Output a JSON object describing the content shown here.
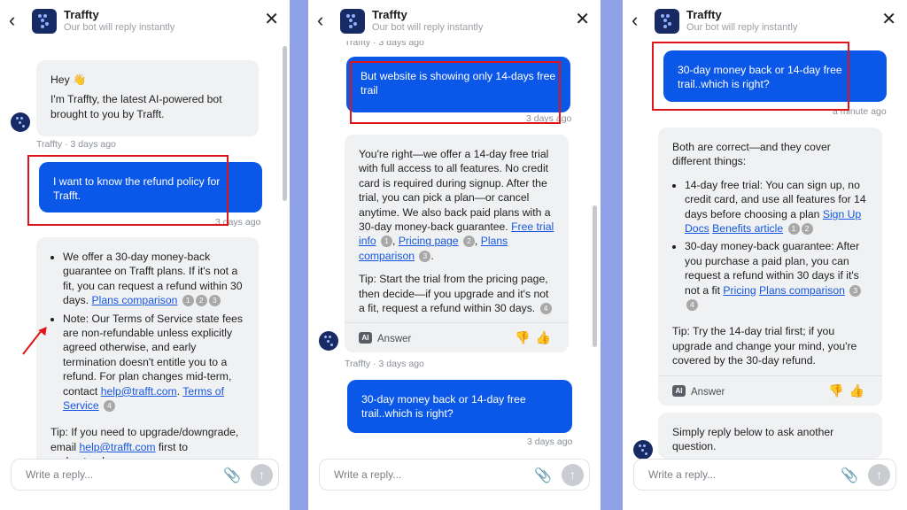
{
  "header": {
    "bot_name": "Traffty",
    "subtitle": "Our bot will reply instantly"
  },
  "input": {
    "placeholder": "Write a reply..."
  },
  "icons": {
    "back": "chevron-left-icon",
    "close": "close-icon",
    "attach": "paperclip-icon",
    "send": "arrow-up-icon",
    "thumbs_down": "thumbs-down-icon",
    "thumbs_up": "thumbs-up-icon"
  },
  "colors": {
    "user_bubble": "#0b57e8",
    "bot_bubble": "#f0f1f3",
    "annotation": "#e0141b",
    "link": "#1557e0",
    "background": "#8ea0e6"
  },
  "panel1": {
    "greeting_line1": "Hey 👋",
    "greeting_line2": "I'm Traffty, the latest AI-powered bot brought to you by Trafft.",
    "greeting_meta": "Traffty · 3 days ago",
    "user_msg": "I want to know the refund policy for Trafft.",
    "user_meta": "3 days ago",
    "b1_text": "We offer a 30-day money-back guarantee on Trafft plans. If it's not a fit, you can request a refund within 30 days.",
    "b1_link": "Plans comparison",
    "b1_cites": [
      "1",
      "2",
      "3"
    ],
    "b2_text": "Note: Our Terms of Service state fees are non-refundable unless explicitly agreed otherwise, and early termination doesn't entitle you to a refund. For plan changes mid-term, contact",
    "b2_email": "help@trafft.com",
    "b2_link": "Terms of Service",
    "b2_cite": "4",
    "tip_prefix": "Tip: If you need to upgrade/downgrade, email",
    "tip_email": "help@trafft.com",
    "tip_suffix": "first to understand"
  },
  "panel2": {
    "top_meta": "Traffty · 3 days ago",
    "user_msg1": "But website is showing only 14-days free trail",
    "user_meta1": "3 days ago",
    "bot_para": "You're right—we offer a 14-day free trial with full access to all features. No credit card is required during signup. After the trial, you can pick a plan—or cancel anytime. We also back paid plans with a 30-day money-back guarantee.",
    "link1": "Free trial info",
    "cite1": "1",
    "link2": "Pricing page",
    "cite2": "2",
    "link3": "Plans comparison",
    "cite3": "3",
    "tip": "Tip: Start the trial from the pricing page, then decide—if you upgrade and it's not a fit, request a refund within 30 days.",
    "tip_cite": "4",
    "answer_badge": "AI",
    "answer_label": "Answer",
    "bot_meta": "Traffty · 3 days ago",
    "user_msg2": "30-day money back or 14-day free trail..which is right?",
    "user_meta2": "3 days ago"
  },
  "panel3": {
    "user_msg": "30-day money back or 14-day free trail..which is right?",
    "user_meta": "a minute ago",
    "intro": "Both are correct—and they cover different things:",
    "li1_text": "14-day free trial: You can sign up, no credit card, and use all features for 14 days before choosing a plan",
    "li1_link1": "Sign Up Docs",
    "li1_link2": "Benefits article",
    "li1_cites": [
      "1",
      "2"
    ],
    "li2_text": "30-day money-back guarantee: After you purchase a paid plan, you can request a refund within 30 days if it's not a fit",
    "li2_link1": "Pricing",
    "li2_link2": "Plans comparison",
    "li2_cites": [
      "3",
      "4"
    ],
    "tip": "Tip: Try the 14-day trial first; if you upgrade and change your mind, you're covered by the 30-day refund.",
    "answer_badge": "AI",
    "answer_label": "Answer",
    "followup": "Simply reply below to ask another question."
  }
}
